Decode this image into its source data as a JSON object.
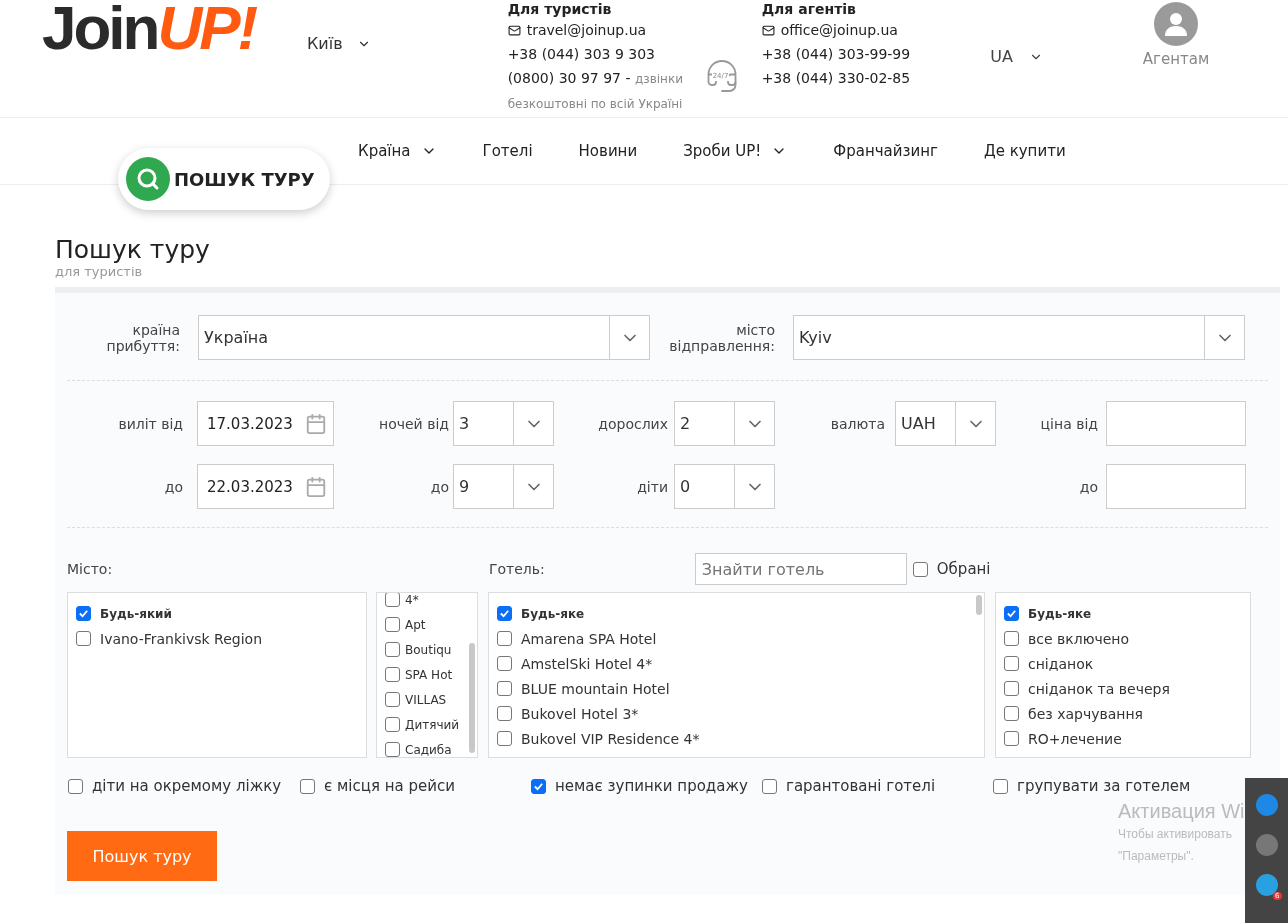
{
  "header": {
    "logo": {
      "dark": "Join",
      "bright": "UP!"
    },
    "city": "Київ",
    "tourists": {
      "title": "Для туристів",
      "email": "travel@joinup.ua",
      "phone": "+38 (044) 303 9 303",
      "hotline": "(0800) 30 97 97 -",
      "hotline_note": "дзвінки безкоштовні по всій Україні"
    },
    "support_badge": "24/7",
    "agents": {
      "title": "Для агентів",
      "email": "office@joinup.ua",
      "phones": [
        "+38 (044) 303-99-99",
        "+38 (044) 330-02-85"
      ]
    },
    "language": "UA",
    "account": "Агентам"
  },
  "nav": [
    {
      "label": "Країна",
      "dropdown": true
    },
    {
      "label": "Готелі",
      "dropdown": false
    },
    {
      "label": "Новини",
      "dropdown": false
    },
    {
      "label": "Зроби UP!",
      "dropdown": true
    },
    {
      "label": "Франчайзинг",
      "dropdown": false
    },
    {
      "label": "Де купити",
      "dropdown": false
    }
  ],
  "search_pill": "ПОШУК ТУРУ",
  "page": {
    "title": "Пошук туру",
    "subtitle": "для туристів"
  },
  "destination": [
    {
      "label": "країна прибуття:",
      "value": "Україна"
    },
    {
      "label": "місто відправлення:",
      "value": "Kyiv"
    }
  ],
  "field_rows": [
    [
      {
        "kind": "date",
        "label": "виліт від",
        "value": "17.03.2023"
      },
      {
        "kind": "select",
        "label": "ночей від",
        "value": "3"
      },
      {
        "kind": "select",
        "label": "дорослих",
        "value": "2"
      },
      {
        "kind": "select",
        "label": "валюта",
        "value": "UAH"
      },
      {
        "kind": "input",
        "label": "ціна від"
      }
    ],
    [
      {
        "kind": "date",
        "label": "до",
        "value": "22.03.2023"
      },
      {
        "kind": "select",
        "label": "до",
        "value": "9"
      },
      {
        "kind": "select",
        "label": "діти",
        "value": "0"
      },
      {
        "kind": "blank"
      },
      {
        "kind": "input",
        "label": "до"
      }
    ]
  ],
  "city_label": "Місто:",
  "hotel_label": "Готель:",
  "hotel_search": {
    "placeholder": "Знайти готель"
  },
  "favorites": {
    "label": "Обрані",
    "checked": false
  },
  "cities": [
    {
      "kind": "any",
      "label": "Будь-який",
      "checked": true
    },
    {
      "kind": "option",
      "label": "Ivano-Frankivsk Region",
      "checked": false
    }
  ],
  "categories": [
    {
      "label": "4*",
      "checked": false
    },
    {
      "label": "Apt",
      "checked": false
    },
    {
      "label": "Boutiqu",
      "checked": false
    },
    {
      "label": "SPA Hot",
      "checked": false
    },
    {
      "label": "VILLAS",
      "checked": false
    },
    {
      "label": "Дитячий",
      "checked": false
    },
    {
      "label": "Садиба",
      "checked": false
    }
  ],
  "hotels": [
    {
      "kind": "any",
      "label": "Будь-яке",
      "checked": true
    },
    {
      "kind": "option",
      "label": "Amarena SPA Hotel",
      "checked": false
    },
    {
      "kind": "option",
      "label": "AmstelSki Hotel 4*",
      "checked": false
    },
    {
      "kind": "option",
      "label": "BLUE mountain Hotel",
      "checked": false
    },
    {
      "kind": "option",
      "label": "Bukovel Hotel 3*",
      "checked": false
    },
    {
      "kind": "option",
      "label": "Bukovel VIP Residence 4*",
      "checked": false
    }
  ],
  "meals": [
    {
      "kind": "any",
      "label": "Будь-яке",
      "checked": true
    },
    {
      "kind": "option",
      "label": "все включено",
      "checked": false
    },
    {
      "kind": "option",
      "label": "сніданок",
      "checked": false
    },
    {
      "kind": "option",
      "label": "сніданок та вечеря",
      "checked": false
    },
    {
      "kind": "option",
      "label": "без харчування",
      "checked": false
    },
    {
      "kind": "option",
      "label": "RO+лечение",
      "checked": false
    }
  ],
  "options": [
    {
      "label": "діти на окремому ліжку",
      "checked": false
    },
    {
      "label": "є місця на рейси",
      "checked": false
    },
    {
      "label": "немає зупинки продажу",
      "checked": true
    },
    {
      "label": "гарантовані готелі",
      "checked": false
    },
    {
      "label": "групувати за готелем",
      "checked": false
    }
  ],
  "submit": "Пошук туру",
  "os_overlay": {
    "title": "Активация Wi",
    "lines": [
      "Чтобы активировать",
      "\"Параметры\"."
    ],
    "notifications": "6"
  }
}
